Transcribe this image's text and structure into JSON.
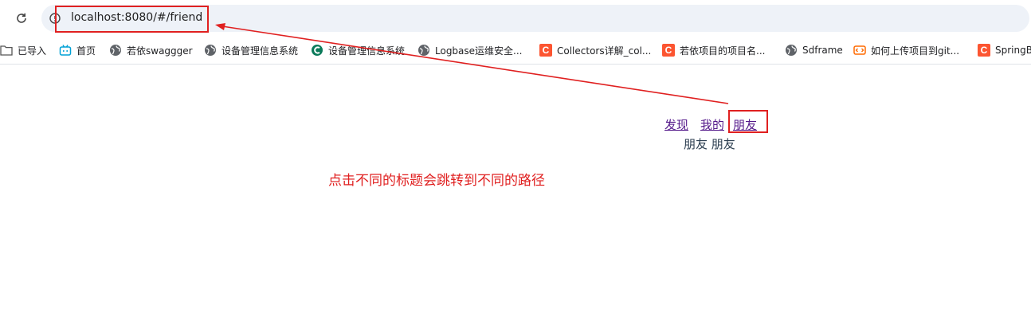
{
  "browser": {
    "url": "localhost:8080/#/friend",
    "bookmarks": [
      {
        "label": "已导入",
        "icon": "folder-icon"
      },
      {
        "label": "首页",
        "icon": "bilibili-icon"
      },
      {
        "label": "若依swaggger",
        "icon": "globe-icon"
      },
      {
        "label": "设备管理信息系统",
        "icon": "globe-icon"
      },
      {
        "label": "设备管理信息系统",
        "icon": "green-c-icon"
      },
      {
        "label": "Logbase运维安全...",
        "icon": "globe-icon"
      },
      {
        "label": "Collectors详解_col...",
        "icon": "csdn-icon"
      },
      {
        "label": "若依项目的项目名...",
        "icon": "csdn-icon"
      },
      {
        "label": "Sdframe",
        "icon": "globe-icon"
      },
      {
        "label": "如何上传项目到git...",
        "icon": "code-icon"
      },
      {
        "label": "SpringB",
        "icon": "csdn-icon"
      }
    ]
  },
  "page": {
    "nav": {
      "discover": "发现",
      "mine": "我的",
      "friend": "朋友"
    },
    "view_text": "朋友 朋友"
  },
  "annotation": {
    "text": "点击不同的标题会跳转到不同的路径",
    "color": "#e02020"
  },
  "colors": {
    "link_visited": "#551a8b",
    "text": "#2c3e50",
    "csdn": "#fc5531"
  }
}
